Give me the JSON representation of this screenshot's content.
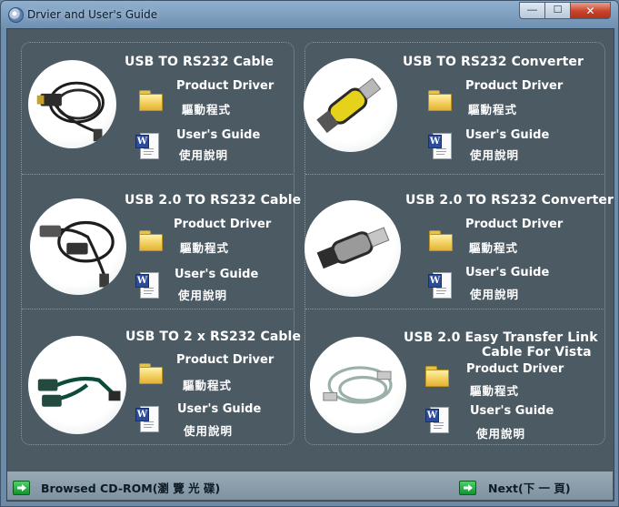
{
  "window": {
    "title": "Drvier and User's Guide",
    "controls": {
      "minimize": "—",
      "maximize": "☐",
      "close": "✕"
    }
  },
  "products": [
    {
      "name": "USB  TO RS232 Cable",
      "driver_label": "Product Driver",
      "driver_cn": "驅動程式",
      "guide_label": "User's Guide",
      "guide_cn": "使用說明"
    },
    {
      "name": "USB  TO RS232 Converter",
      "driver_label": "Product Driver",
      "driver_cn": "驅動程式",
      "guide_label": "User's Guide",
      "guide_cn": "使用說明"
    },
    {
      "name": "USB 2.0 TO RS232 Cable",
      "driver_label": "Product Driver",
      "driver_cn": "驅動程式",
      "guide_label": "User's Guide",
      "guide_cn": "使用說明"
    },
    {
      "name": "USB 2.0 TO RS232  Converter",
      "driver_label": "Product Driver",
      "driver_cn": "驅動程式",
      "guide_label": "User's Guide",
      "guide_cn": "使用說明"
    },
    {
      "name": "USB TO 2 x RS232 Cable",
      "driver_label": "Product Driver",
      "driver_cn": "驅動程式",
      "guide_label": "User's Guide",
      "guide_cn": "使用說明"
    },
    {
      "name": "USB 2.0 Easy Transfer Link",
      "name_line2": "Cable For Vista",
      "driver_label": "Product Driver",
      "driver_cn": "驅動程式",
      "guide_label": "User's Guide",
      "guide_cn": "使用說明"
    }
  ],
  "footer": {
    "browse_label": "Browsed CD-ROM(瀏 覽 光 碟)",
    "next_label": "Next(下 一 頁)"
  },
  "colors": {
    "client_bg": "#4b5a63",
    "accent_green": "#13922f",
    "title_text": "#ffffff"
  },
  "icons": {
    "driver": "folder-icon",
    "guide": "word-document-icon",
    "footer_button": "green-arrow-icon"
  }
}
